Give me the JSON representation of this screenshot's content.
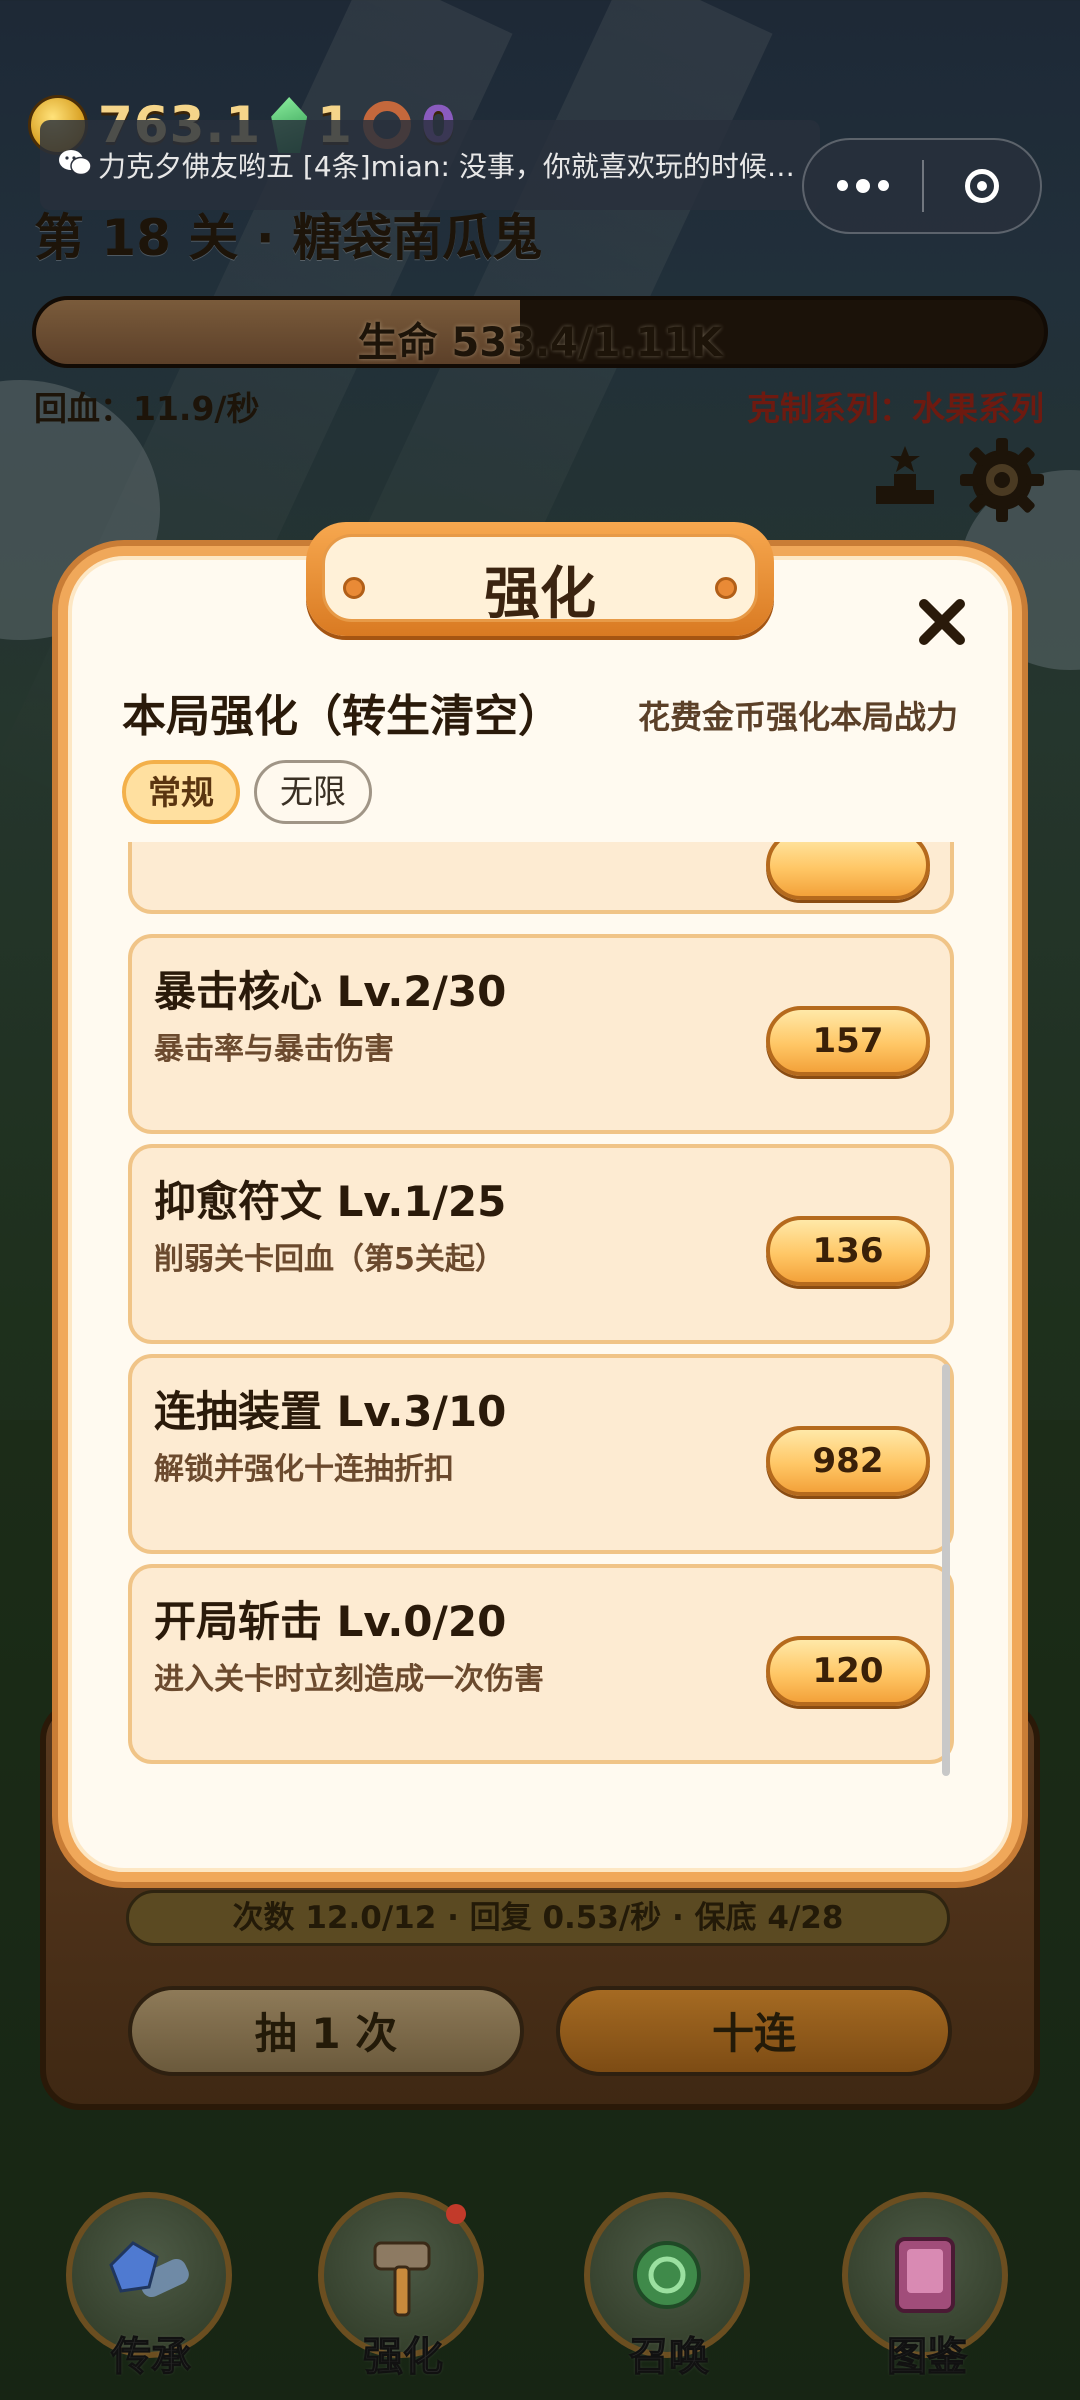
{
  "hud": {
    "coins": "763.1",
    "gems": "1",
    "rings": "0"
  },
  "wechat_notice": {
    "text": "力克夕佛友哟五  [4条]mian: 没事，你就喜欢玩的时候…"
  },
  "stage": {
    "title": "第 18 关 · 糖袋南瓜鬼",
    "hp_text": "生命 533.4/1.11K",
    "hp_fraction": 0.48,
    "regen_text": "回血：11.9/秒",
    "counter_text": "克制系列：水果系列"
  },
  "modal": {
    "title": "强化",
    "section_title": "本局强化（转生清空）",
    "section_subtitle": "花费金币强化本局战力",
    "tabs": [
      {
        "label": "常规",
        "active": true
      },
      {
        "label": "无限",
        "active": false
      }
    ],
    "upgrades": [
      {
        "name": "暴击核心  Lv.2/30",
        "desc": "暴击率与暴击伤害",
        "cost": "157"
      },
      {
        "name": "抑愈符文  Lv.1/25",
        "desc": "削弱关卡回血（第5关起）",
        "cost": "136"
      },
      {
        "name": "连抽装置  Lv.3/10",
        "desc": "解锁并强化十连抽折扣",
        "cost": "982"
      },
      {
        "name": "开局斩击  Lv.0/20",
        "desc": "进入关卡时立刻造成一次伤害",
        "cost": "120"
      }
    ]
  },
  "gacha": {
    "status_text": "次数 12.0/12 · 回复 0.53/秒 · 保底 4/28",
    "draw_one_label": "抽 1 次",
    "draw_ten_label": "十连"
  },
  "nav": {
    "items": [
      {
        "label": "传承",
        "icon": "scroll-crystal-icon"
      },
      {
        "label": "强化",
        "icon": "hammer-icon",
        "badge": true
      },
      {
        "label": "召唤",
        "icon": "summon-orb-icon"
      },
      {
        "label": "图鉴",
        "icon": "book-icon"
      }
    ]
  },
  "colors": {
    "modal_border": "#f0a85a",
    "cost_button": "#ffc766",
    "counter_text": "#6e1a10"
  }
}
